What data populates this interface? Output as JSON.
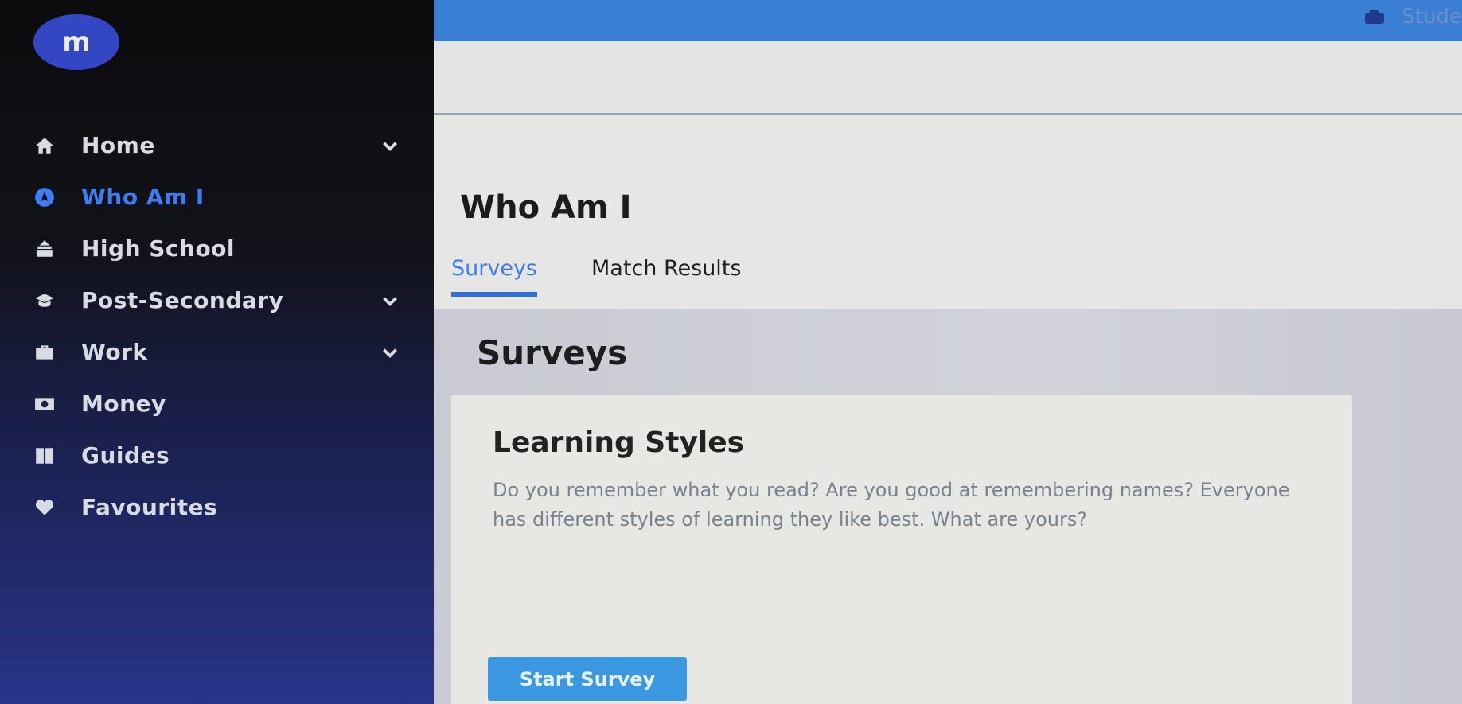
{
  "brand": {
    "logo_text": "m"
  },
  "sidebar": {
    "items": [
      {
        "label": "Home",
        "icon": "home-icon",
        "has_chevron": true,
        "active": false
      },
      {
        "label": "Who Am I",
        "icon": "compass-icon",
        "has_chevron": false,
        "active": true
      },
      {
        "label": "High School",
        "icon": "school-icon",
        "has_chevron": false,
        "active": false
      },
      {
        "label": "Post-Secondary",
        "icon": "graduation-cap-icon",
        "has_chevron": true,
        "active": false
      },
      {
        "label": "Work",
        "icon": "briefcase-icon",
        "has_chevron": true,
        "active": false
      },
      {
        "label": "Money",
        "icon": "money-icon",
        "has_chevron": false,
        "active": false
      },
      {
        "label": "Guides",
        "icon": "book-icon",
        "has_chevron": false,
        "active": false
      },
      {
        "label": "Favourites",
        "icon": "heart-icon",
        "has_chevron": false,
        "active": false
      }
    ]
  },
  "topbar": {
    "user_label": "Stude"
  },
  "page": {
    "title": "Who Am I",
    "tabs": [
      {
        "label": "Surveys",
        "active": true
      },
      {
        "label": "Match Results",
        "active": false
      }
    ]
  },
  "surveys": {
    "section_title": "Surveys",
    "card": {
      "title": "Learning Styles",
      "description": "Do you remember what you read? Are you good at remembering names? Everyone has different styles of learning they like best. What are yours?",
      "button_label": "Start Survey"
    }
  },
  "colors": {
    "accent": "#3e7cf0",
    "topbar": "#3a7fd4",
    "button": "#3b98e0"
  }
}
